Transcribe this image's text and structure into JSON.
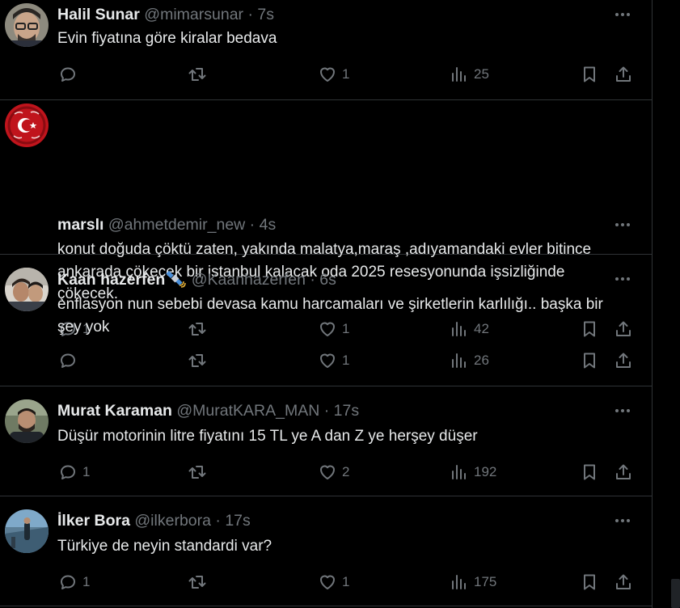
{
  "tweets": [
    {
      "name": "Halil Sunar",
      "handle": "@mimarsunar",
      "time": "7s",
      "text": "Evin fiyatına göre kiralar bedava",
      "replies": "",
      "retweets": "",
      "likes": "1",
      "views": "25"
    },
    {
      "name": "marslı",
      "handle": "@ahmetdemir_new",
      "time": "4s",
      "text": "konut doğuda çöktü zaten,  yakında malatya,maraş ,adıyamandaki evler bitince ankarada çökecek bir istanbul kalacak oda 2025 resesyonunda işsizliğinde çökecek.",
      "replies": "1",
      "retweets": "",
      "likes": "1",
      "views": "42"
    },
    {
      "name": "Kaan hazerfen",
      "handle": "@Kaanhazerfen",
      "time": "6s",
      "text": "enflasyon nun sebebi devasa kamu harcamaları ve şirketlerin karlılığı.. başka bir şey yok",
      "replies": "",
      "retweets": "",
      "likes": "1",
      "views": "26"
    },
    {
      "name": "Murat Karaman",
      "handle": "@MuratKARA_MAN",
      "time": "17s",
      "text": "Düşür motorinin litre fiyatını 15 TL ye A dan Z ye herşey düşer",
      "replies": "1",
      "retweets": "",
      "likes": "2",
      "views": "192"
    },
    {
      "name": "İlker Bora",
      "handle": "@ilkerbora",
      "time": "17s",
      "text": "Türkiye de neyin standardi var?",
      "replies": "1",
      "retweets": "",
      "likes": "1",
      "views": "175"
    }
  ],
  "separator": "·",
  "icons": {
    "reply": "reply-icon",
    "retweet": "retweet-icon",
    "like": "heart-icon",
    "views": "views-icon",
    "bookmark": "bookmark-icon",
    "share": "share-icon",
    "more": "more-icon"
  },
  "colors": {
    "background": "#000000",
    "text": "#e7e9ea",
    "muted": "#71767b",
    "border": "#2f3336"
  }
}
